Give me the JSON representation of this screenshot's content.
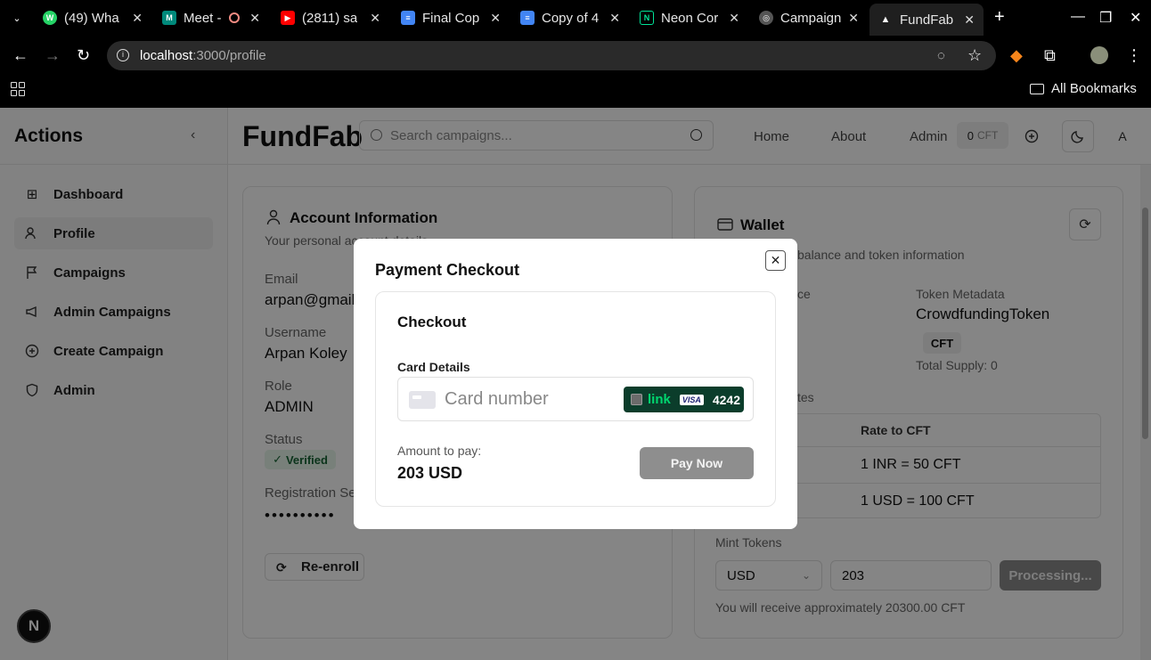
{
  "browser": {
    "tabs": [
      {
        "label": "(49) Wha",
        "color": "#25d366",
        "glyph": "W"
      },
      {
        "label": "Meet -",
        "color": "#00897b",
        "glyph": "M"
      },
      {
        "label": "(2811) sa",
        "color": "#ff0000",
        "glyph": "▶"
      },
      {
        "label": "Final Cop",
        "color": "#4285f4",
        "glyph": "≡"
      },
      {
        "label": "Copy of 4",
        "color": "#4285f4",
        "glyph": "≡"
      },
      {
        "label": "Neon Cor",
        "color": "#0b0b0b",
        "glyph": "N"
      },
      {
        "label": "Campaign",
        "color": "#555555",
        "glyph": "◎"
      },
      {
        "label": "FundFab",
        "color": "#1f1f1f",
        "glyph": "▲"
      }
    ],
    "url_host": "localhost",
    "url_path": ":3000/profile",
    "bookmarks_label": "All Bookmarks"
  },
  "sidebar": {
    "title": "Actions",
    "items": [
      {
        "label": "Dashboard",
        "icon": "⊞"
      },
      {
        "label": "Profile",
        "icon": "👥"
      },
      {
        "label": "Campaigns",
        "icon": "⚑"
      },
      {
        "label": "Admin Campaigns",
        "icon": "📣"
      },
      {
        "label": "Create Campaign",
        "icon": "⊕"
      },
      {
        "label": "Admin",
        "icon": "⛉"
      }
    ]
  },
  "header": {
    "brand": "FundFab",
    "search_placeholder": "Search campaigns...",
    "nav": [
      "Home",
      "About",
      "Admin"
    ],
    "balance": "0",
    "balance_unit": "CFT",
    "avatar": "A"
  },
  "account": {
    "title": "Account Information",
    "subtitle": "Your personal account details",
    "email_label": "Email",
    "email_value": "arpan@gmail.",
    "username_label": "Username",
    "username_value": "Arpan Koley",
    "role_label": "Role",
    "role_value": "ADMIN",
    "status_label": "Status",
    "status_value": "Verified",
    "secret_label": "Registration Se",
    "secret_value": "••••••••••",
    "reenroll_label": "Re-enroll"
  },
  "wallet": {
    "title": "Wallet",
    "subtitle": "balance and token information",
    "balance_label": "ce",
    "metadata_label": "Token Metadata",
    "token_name": "CrowdfundingToken",
    "token_symbol": "CFT",
    "total_supply": "Total Supply: 0",
    "rates_label": "tes",
    "rate_header": "Rate to CFT",
    "rates": [
      "1 INR = 50 CFT",
      "1 USD = 100 CFT"
    ],
    "mint_label": "Mint Tokens",
    "currency": "USD",
    "amount": "203",
    "processing_label": "Processing...",
    "receive_note": "You will receive approximately 20300.00 CFT"
  },
  "modal": {
    "title": "Payment Checkout",
    "checkout_title": "Checkout",
    "card_details_label": "Card Details",
    "card_placeholder": "Card number",
    "link_label": "link",
    "card_brand": "VISA",
    "card_last4": "4242",
    "amount_label": "Amount to pay:",
    "amount_value": "203 USD",
    "pay_label": "Pay Now"
  }
}
